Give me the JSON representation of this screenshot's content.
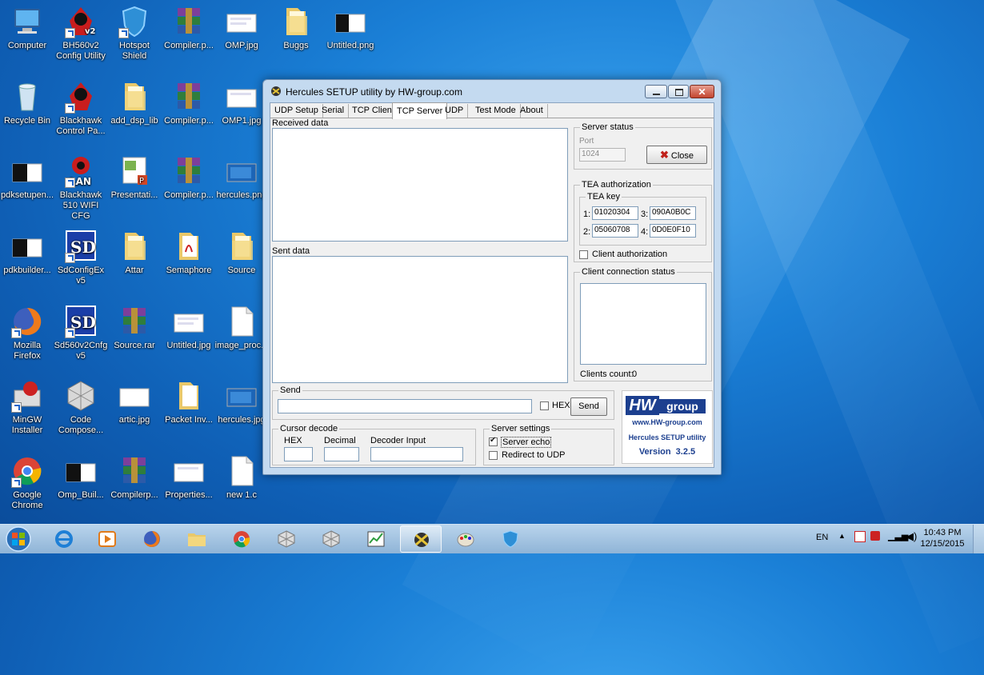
{
  "desktop": {
    "icons": [
      {
        "label": "Computer"
      },
      {
        "label": "BH560v2 Config Utility"
      },
      {
        "label": "Hotspot Shield"
      },
      {
        "label": "Compiler.p..."
      },
      {
        "label": "OMP.jpg"
      },
      {
        "label": "Buggs"
      },
      {
        "label": "Untitled.png"
      },
      {
        "label": "Recycle Bin"
      },
      {
        "label": "Blackhawk Control Pa..."
      },
      {
        "label": "add_dsp_lib"
      },
      {
        "label": "Compiler.p..."
      },
      {
        "label": "OMP1.jpg"
      },
      {
        "label": "pdksetupen..."
      },
      {
        "label": "Blackhawk 510 WIFI CFG"
      },
      {
        "label": "Presentati..."
      },
      {
        "label": "Compiler.p..."
      },
      {
        "label": "hercules.png"
      },
      {
        "label": "pdkbuilder..."
      },
      {
        "label": "SdConfigEx v5"
      },
      {
        "label": "Attar"
      },
      {
        "label": "Semaphore"
      },
      {
        "label": "Source"
      },
      {
        "label": "Mozilla Firefox"
      },
      {
        "label": "Sd560v2Cnfg v5"
      },
      {
        "label": "Source.rar"
      },
      {
        "label": "Untitled.jpg"
      },
      {
        "label": "image_proc..."
      },
      {
        "label": "MinGW Installer"
      },
      {
        "label": "Code Compose..."
      },
      {
        "label": "artic.jpg"
      },
      {
        "label": "Packet Inv..."
      },
      {
        "label": "hercules.jpg"
      },
      {
        "label": "Google Chrome"
      },
      {
        "label": "Omp_Buil..."
      },
      {
        "label": "Compilerp..."
      },
      {
        "label": "Properties..."
      },
      {
        "label": "new 1.c"
      }
    ]
  },
  "window": {
    "title": "Hercules SETUP utility by HW-group.com",
    "close_glyph": "✕",
    "tabs": [
      {
        "label": "UDP Setup"
      },
      {
        "label": "Serial"
      },
      {
        "label": "TCP Client"
      },
      {
        "label": "TCP Server",
        "active": true
      },
      {
        "label": "UDP"
      },
      {
        "label": "Test Mode"
      },
      {
        "label": "About"
      }
    ],
    "received_label": "Received data",
    "sent_label": "Sent data",
    "server_status": {
      "title": "Server status",
      "port_label": "Port",
      "port_value": "1024",
      "close_button": "Close"
    },
    "tea": {
      "title": "TEA authorization",
      "key_title": "TEA key",
      "keys": [
        {
          "label": "1:",
          "value": "01020304"
        },
        {
          "label": "3:",
          "value": "090A0B0C"
        },
        {
          "label": "2:",
          "value": "05060708"
        },
        {
          "label": "4:",
          "value": "0D0E0F10"
        }
      ],
      "client_auth_label": "Client authorization"
    },
    "client_status": {
      "title": "Client connection status",
      "clients_count_label": "Clients count:",
      "clients_count_value": "0"
    },
    "send": {
      "title": "Send",
      "hex_label": "HEX",
      "send_button": "Send"
    },
    "cursor_decode": {
      "title": "Cursor decode",
      "hex_label": "HEX",
      "decimal_label": "Decimal",
      "decoder_label": "Decoder Input"
    },
    "server_settings": {
      "title": "Server settings",
      "server_echo_label": "Server echo",
      "server_echo_checked": true,
      "redirect_label": "Redirect to UDP",
      "redirect_checked": false
    },
    "logo": {
      "brand_hw": "HW",
      "brand_group": "group",
      "url": "www.HW-group.com",
      "product": "Hercules SETUP utility",
      "version": "Version  3.2.5"
    }
  },
  "taskbar": {
    "language": "EN",
    "time": "10:43 PM",
    "date": "12/15/2015"
  }
}
